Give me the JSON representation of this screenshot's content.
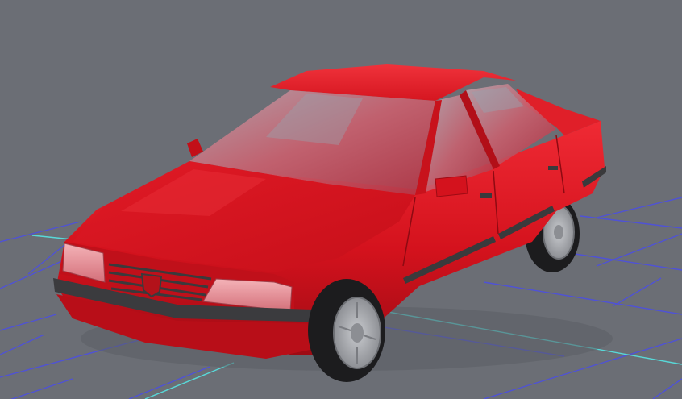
{
  "viewport": {
    "background_color": "#6b6e75",
    "grid_line_color": "#4f52d6",
    "grid_axis_color": "#58d8d8",
    "model": {
      "name": "",
      "body_color": "#d6141f",
      "glass_color": "#c87b88",
      "trim_color": "#3a3a3c",
      "wheel_color": "#a7a9ae"
    }
  }
}
